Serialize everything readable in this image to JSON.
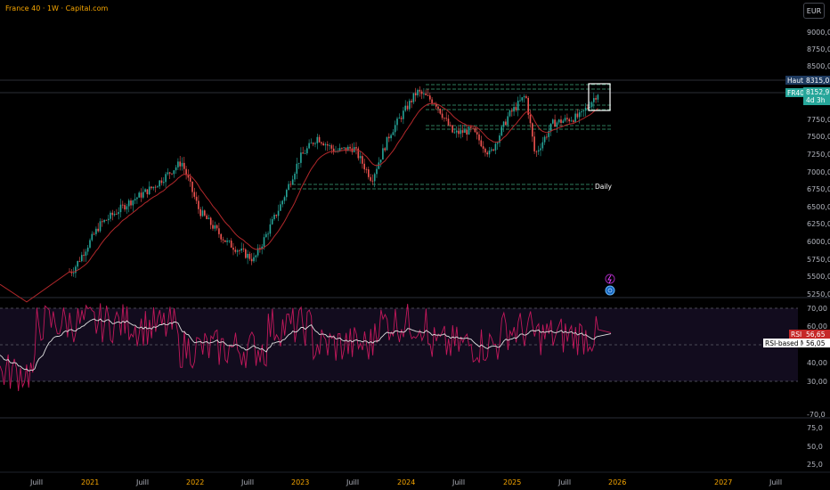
{
  "header": {
    "title": "France 40 · 1W · Capital.com",
    "currency_button": "EUR"
  },
  "price_scale": {
    "ticks": [
      "9000,0",
      "8750,0",
      "8500,0",
      "7750,0",
      "7500,0",
      "7250,0",
      "7000,0",
      "6750,0",
      "6500,0",
      "6250,0",
      "6000,0",
      "5750,0",
      "5500,0",
      "5250,0"
    ],
    "badges": [
      {
        "name": "Haut",
        "value": "8315,0"
      },
      {
        "name": "FR40",
        "value": "8152,9",
        "sub": "4d 3h"
      }
    ]
  },
  "rsi_scale": {
    "ticks": [
      "70,00",
      "60,00",
      "40,00",
      "30,00",
      "-70,0"
    ],
    "badges": [
      {
        "name": "RSI",
        "value": "56,65"
      },
      {
        "name": "RSI-based MA",
        "value": "56,05"
      }
    ]
  },
  "lower_scale": {
    "ticks": [
      "75,0",
      "50,0",
      "25,0"
    ]
  },
  "time_axis": {
    "labels": [
      "Juill",
      "2021",
      "Juill",
      "2022",
      "Juill",
      "2023",
      "Juill",
      "2024",
      "Juill",
      "2025",
      "Juill",
      "2026",
      "2027",
      "Juill"
    ],
    "year_labels": [
      "2021",
      "2022",
      "2023",
      "2024",
      "2025",
      "2026",
      "2027"
    ]
  },
  "annotations": {
    "support_label": "Daily"
  },
  "colors": {
    "background": "#000000",
    "bull_candle": "#26a69a",
    "bear_candle": "#ef5350",
    "ma_line": "#b2282b",
    "zone_line": "#2e7d5b",
    "rsi_line": "#c2185b",
    "rsi_ma_line": "#e0e0e0",
    "rsi_band": "#120c1e",
    "axis_text": "#b2b5be",
    "year_text": "#f7a600"
  },
  "chart_data": {
    "type": "candlestick",
    "interval": "1W",
    "y_range": [
      5150,
      9150
    ],
    "time_range": [
      "2020-05",
      "2027-09"
    ],
    "close_points": [
      [
        "2020-06",
        4950
      ],
      [
        "2020-09",
        4850
      ],
      [
        "2020-11",
        5500
      ],
      [
        "2021-01",
        5600
      ],
      [
        "2021-04",
        6250
      ],
      [
        "2021-07",
        6550
      ],
      [
        "2021-10",
        6800
      ],
      [
        "2022-01",
        7150
      ],
      [
        "2022-03",
        6450
      ],
      [
        "2022-06",
        6000
      ],
      [
        "2022-09",
        5750
      ],
      [
        "2022-12",
        6550
      ],
      [
        "2023-02",
        7200
      ],
      [
        "2023-04",
        7500
      ],
      [
        "2023-06",
        7300
      ],
      [
        "2023-08",
        7350
      ],
      [
        "2023-10",
        6900
      ],
      [
        "2023-12",
        7550
      ],
      [
        "2024-03",
        8150
      ],
      [
        "2024-05",
        8000
      ],
      [
        "2024-07",
        7550
      ],
      [
        "2024-09",
        7600
      ],
      [
        "2024-11",
        7250
      ],
      [
        "2025-01",
        7800
      ],
      [
        "2025-03",
        8100
      ],
      [
        "2025-04",
        7250
      ],
      [
        "2025-06",
        7700
      ],
      [
        "2025-09",
        7800
      ],
      [
        "2025-11",
        8150
      ]
    ],
    "horizontal_levels": [
      8150,
      8000,
      7650,
      6780
    ],
    "rsi": {
      "y_range": [
        20,
        80
      ],
      "levels": [
        70,
        50,
        30
      ],
      "last_value": 56.65,
      "ma_last_value": 56.05
    }
  }
}
